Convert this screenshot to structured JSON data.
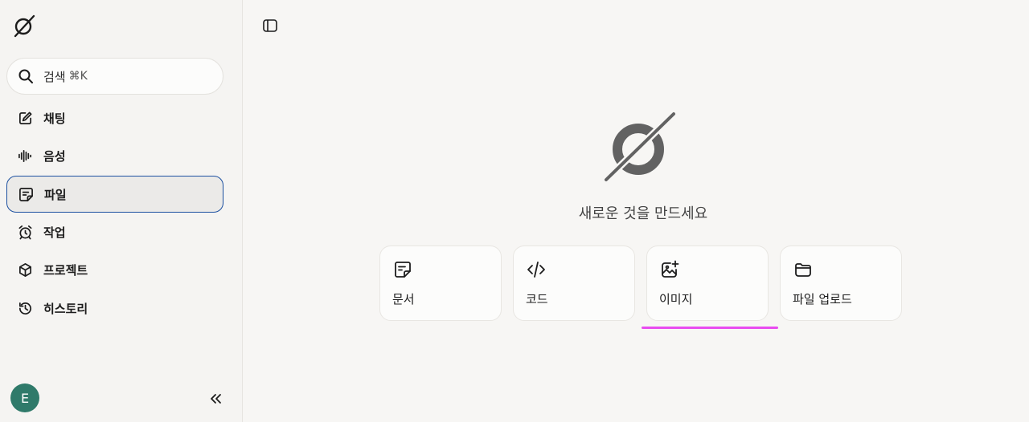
{
  "sidebar": {
    "search": {
      "label": "검색",
      "shortcut": "⌘K"
    },
    "items": [
      {
        "label": "채팅",
        "icon": "edit-icon"
      },
      {
        "label": "음성",
        "icon": "waveform-icon"
      },
      {
        "label": "파일",
        "icon": "file-icon",
        "active": true
      },
      {
        "label": "작업",
        "icon": "alarm-clock-icon"
      },
      {
        "label": "프로젝트",
        "icon": "cube-icon"
      },
      {
        "label": "히스토리",
        "icon": "history-icon"
      }
    ],
    "user": {
      "avatar_initial": "E",
      "avatar_color": "#2f7a6a"
    }
  },
  "main": {
    "title": "새로운 것을 만드세요",
    "cards": [
      {
        "label": "문서",
        "icon": "document-icon"
      },
      {
        "label": "코드",
        "icon": "code-icon"
      },
      {
        "label": "이미지",
        "icon": "image-plus-icon"
      },
      {
        "label": "파일 업로드",
        "icon": "folder-icon"
      }
    ]
  },
  "colors": {
    "active_border": "#1b4fa0",
    "highlight_underline": "#e84bf0"
  }
}
